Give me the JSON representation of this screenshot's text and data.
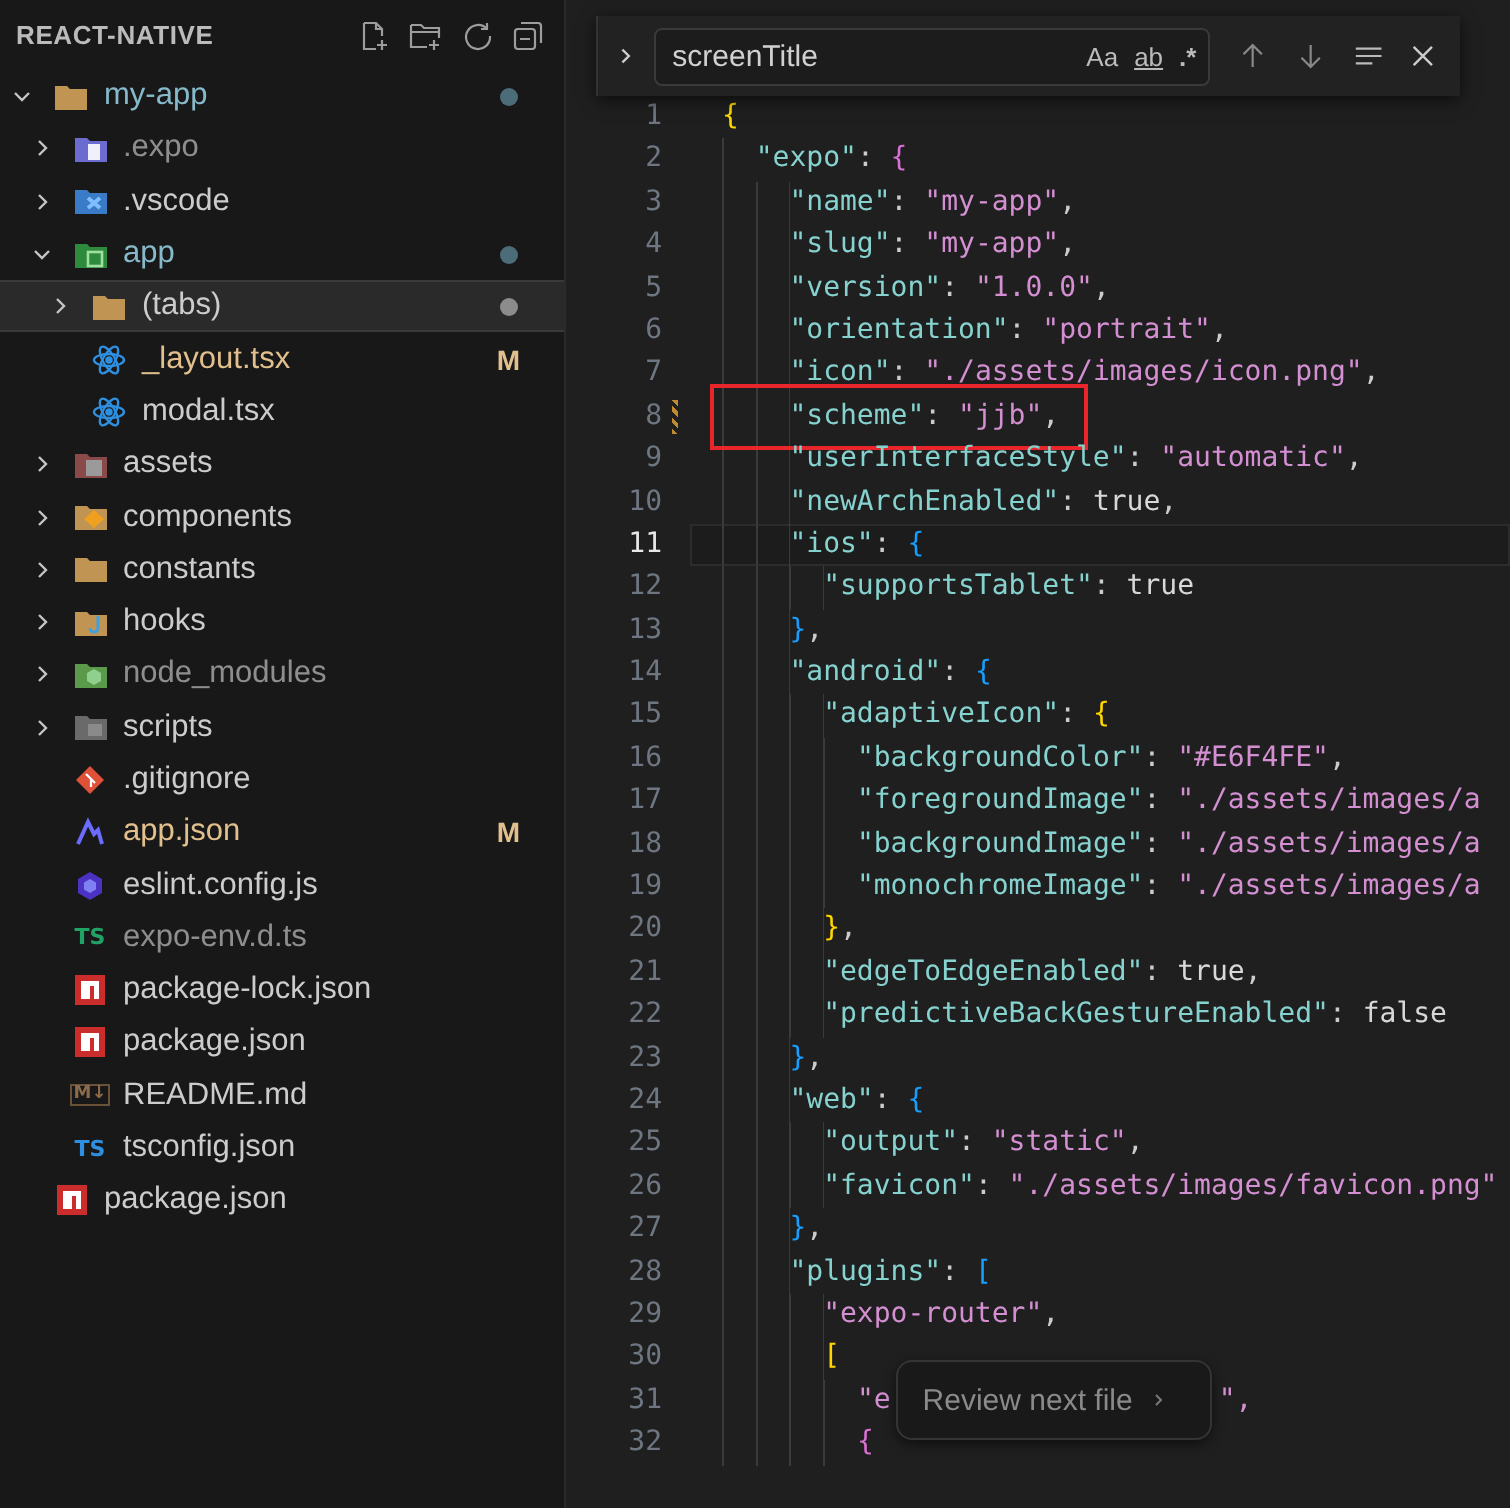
{
  "sidebar": {
    "title": "REACT-NATIVE",
    "tree": [
      {
        "name": "my-app",
        "kind": "folder",
        "expanded": true,
        "has_changes": true,
        "modified": false,
        "ignored": false,
        "selected": false,
        "color": "#4d6c7a",
        "children": [
          {
            "name": ".expo",
            "kind": "expo-folder",
            "expanded": false,
            "has_changes": false,
            "modified": false,
            "ignored": true,
            "selected": false
          },
          {
            "name": ".vscode",
            "kind": "vscode-folder",
            "expanded": false,
            "has_changes": false,
            "modified": false,
            "ignored": false,
            "selected": false
          },
          {
            "name": "app",
            "kind": "app-folder",
            "expanded": true,
            "has_changes": true,
            "modified": false,
            "ignored": false,
            "selected": false,
            "color": "#4d6c7a",
            "children": [
              {
                "name": "(tabs)",
                "kind": "folder",
                "expanded": false,
                "has_changes": false,
                "modified": false,
                "ignored": false,
                "selected": true,
                "color": "#8c8c8c"
              },
              {
                "name": "_layout.tsx",
                "kind": "react",
                "has_changes": false,
                "modified": true,
                "ignored": false,
                "selected": false,
                "badge": "M"
              },
              {
                "name": "modal.tsx",
                "kind": "react",
                "has_changes": false,
                "modified": false,
                "ignored": false,
                "selected": false
              }
            ]
          },
          {
            "name": "assets",
            "kind": "assets-folder",
            "expanded": false,
            "has_changes": false,
            "modified": false,
            "ignored": false,
            "selected": false
          },
          {
            "name": "components",
            "kind": "components-folder",
            "expanded": false,
            "has_changes": false,
            "modified": false,
            "ignored": false,
            "selected": false
          },
          {
            "name": "constants",
            "kind": "folder",
            "expanded": false,
            "has_changes": false,
            "modified": false,
            "ignored": false,
            "selected": false
          },
          {
            "name": "hooks",
            "kind": "hooks-folder",
            "expanded": false,
            "has_changes": false,
            "modified": false,
            "ignored": false,
            "selected": false
          },
          {
            "name": "node_modules",
            "kind": "node-folder",
            "expanded": false,
            "has_changes": false,
            "modified": false,
            "ignored": true,
            "selected": false
          },
          {
            "name": "scripts",
            "kind": "scripts-folder",
            "expanded": false,
            "has_changes": false,
            "modified": false,
            "ignored": false,
            "selected": false
          },
          {
            "name": ".gitignore",
            "kind": "git",
            "has_changes": false,
            "modified": false,
            "ignored": false,
            "selected": false
          },
          {
            "name": "app.json",
            "kind": "expo-file",
            "has_changes": false,
            "modified": true,
            "ignored": false,
            "selected": false,
            "badge": "M"
          },
          {
            "name": "eslint.config.js",
            "kind": "eslint",
            "has_changes": false,
            "modified": false,
            "ignored": false,
            "selected": false
          },
          {
            "name": "expo-env.d.ts",
            "kind": "ts",
            "glyph": "TS",
            "has_changes": false,
            "modified": false,
            "ignored": true,
            "selected": false
          },
          {
            "name": "package-lock.json",
            "kind": "npm",
            "has_changes": false,
            "modified": false,
            "ignored": false,
            "selected": false
          },
          {
            "name": "package.json",
            "kind": "npm",
            "has_changes": false,
            "modified": false,
            "ignored": false,
            "selected": false
          },
          {
            "name": "README.md",
            "kind": "markdown",
            "glyph": "M↓",
            "has_changes": false,
            "modified": false,
            "ignored": false,
            "selected": false
          },
          {
            "name": "tsconfig.json",
            "kind": "tsconfig",
            "glyph": "TS",
            "has_changes": false,
            "modified": false,
            "ignored": false,
            "selected": false
          }
        ]
      },
      {
        "name": "package.json",
        "kind": "npm",
        "has_changes": false,
        "modified": false,
        "ignored": false,
        "selected": false
      }
    ]
  },
  "find": {
    "value": "screenTitle",
    "options": [
      "Aa",
      "ab",
      ".*"
    ]
  },
  "editor": {
    "lines": [
      {
        "n": "1",
        "tokens": [
          {
            "t": "{",
            "kind": "bracket1"
          }
        ]
      },
      {
        "n": "2",
        "tokens": [
          {
            "t": "  \"expo\"",
            "kind": "key"
          },
          {
            "t": ": ",
            "kind": "punct"
          },
          {
            "t": "{",
            "kind": "bracket2"
          }
        ]
      },
      {
        "n": "3",
        "tokens": [
          {
            "t": "    \"name\"",
            "kind": "key"
          },
          {
            "t": ": ",
            "kind": "punct"
          },
          {
            "t": "\"my-app\"",
            "kind": "string"
          },
          {
            "t": ",",
            "kind": "punct"
          }
        ]
      },
      {
        "n": "4",
        "tokens": [
          {
            "t": "    \"slug\"",
            "kind": "key"
          },
          {
            "t": ": ",
            "kind": "punct"
          },
          {
            "t": "\"my-app\"",
            "kind": "string"
          },
          {
            "t": ",",
            "kind": "punct"
          }
        ]
      },
      {
        "n": "5",
        "tokens": [
          {
            "t": "    \"version\"",
            "kind": "key"
          },
          {
            "t": ": ",
            "kind": "punct"
          },
          {
            "t": "\"1.0.0\"",
            "kind": "string"
          },
          {
            "t": ",",
            "kind": "punct"
          }
        ]
      },
      {
        "n": "6",
        "tokens": [
          {
            "t": "    \"orientation\"",
            "kind": "key"
          },
          {
            "t": ": ",
            "kind": "punct"
          },
          {
            "t": "\"portrait\"",
            "kind": "string"
          },
          {
            "t": ",",
            "kind": "punct"
          }
        ]
      },
      {
        "n": "7",
        "tokens": [
          {
            "t": "    \"icon\"",
            "kind": "key"
          },
          {
            "t": ": ",
            "kind": "punct"
          },
          {
            "t": "\"./assets/images/icon.png\"",
            "kind": "string"
          },
          {
            "t": ",",
            "kind": "punct"
          }
        ]
      },
      {
        "n": "8",
        "boxed": true,
        "modified": true,
        "tokens": [
          {
            "t": "    \"scheme\"",
            "kind": "key"
          },
          {
            "t": ": ",
            "kind": "punct"
          },
          {
            "t": "\"jjb\"",
            "kind": "string"
          },
          {
            "t": ",",
            "kind": "punct"
          }
        ]
      },
      {
        "n": "9",
        "tokens": [
          {
            "t": "    \"userInterfaceStyle\"",
            "kind": "key"
          },
          {
            "t": ": ",
            "kind": "punct"
          },
          {
            "t": "\"automatic\"",
            "kind": "string"
          },
          {
            "t": ",",
            "kind": "punct"
          }
        ]
      },
      {
        "n": "10",
        "tokens": [
          {
            "t": "    \"newArchEnabled\"",
            "kind": "key"
          },
          {
            "t": ": ",
            "kind": "punct"
          },
          {
            "t": "true",
            "kind": "literal"
          },
          {
            "t": ",",
            "kind": "punct"
          }
        ]
      },
      {
        "n": "11",
        "current": true,
        "tokens": [
          {
            "t": "    \"ios\"",
            "kind": "key"
          },
          {
            "t": ": ",
            "kind": "punct"
          },
          {
            "t": "{",
            "kind": "bracket3"
          }
        ]
      },
      {
        "n": "12",
        "tokens": [
          {
            "t": "      \"supportsTablet\"",
            "kind": "key"
          },
          {
            "t": ": ",
            "kind": "punct"
          },
          {
            "t": "true",
            "kind": "literal"
          }
        ]
      },
      {
        "n": "13",
        "tokens": [
          {
            "t": "    }",
            "kind": "bracket3"
          },
          {
            "t": ",",
            "kind": "punct"
          }
        ]
      },
      {
        "n": "14",
        "tokens": [
          {
            "t": "    \"android\"",
            "kind": "key"
          },
          {
            "t": ": ",
            "kind": "punct"
          },
          {
            "t": "{",
            "kind": "bracket3"
          }
        ]
      },
      {
        "n": "15",
        "tokens": [
          {
            "t": "      \"adaptiveIcon\"",
            "kind": "key"
          },
          {
            "t": ": ",
            "kind": "punct"
          },
          {
            "t": "{",
            "kind": "bracket1"
          }
        ]
      },
      {
        "n": "16",
        "tokens": [
          {
            "t": "        \"backgroundColor\"",
            "kind": "key"
          },
          {
            "t": ": ",
            "kind": "punct"
          },
          {
            "t": "\"#E6F4FE\"",
            "kind": "string"
          },
          {
            "t": ",",
            "kind": "punct"
          }
        ]
      },
      {
        "n": "17",
        "tokens": [
          {
            "t": "        \"foregroundImage\"",
            "kind": "key"
          },
          {
            "t": ": ",
            "kind": "punct"
          },
          {
            "t": "\"./assets/images/a",
            "kind": "string"
          }
        ]
      },
      {
        "n": "18",
        "tokens": [
          {
            "t": "        \"backgroundImage\"",
            "kind": "key"
          },
          {
            "t": ": ",
            "kind": "punct"
          },
          {
            "t": "\"./assets/images/a",
            "kind": "string"
          }
        ]
      },
      {
        "n": "19",
        "tokens": [
          {
            "t": "        \"monochromeImage\"",
            "kind": "key"
          },
          {
            "t": ": ",
            "kind": "punct"
          },
          {
            "t": "\"./assets/images/a",
            "kind": "string"
          }
        ]
      },
      {
        "n": "20",
        "tokens": [
          {
            "t": "      }",
            "kind": "bracket1"
          },
          {
            "t": ",",
            "kind": "punct"
          }
        ]
      },
      {
        "n": "21",
        "tokens": [
          {
            "t": "      \"edgeToEdgeEnabled\"",
            "kind": "key"
          },
          {
            "t": ": ",
            "kind": "punct"
          },
          {
            "t": "true",
            "kind": "literal"
          },
          {
            "t": ",",
            "kind": "punct"
          }
        ]
      },
      {
        "n": "22",
        "tokens": [
          {
            "t": "      \"predictiveBackGestureEnabled\"",
            "kind": "key"
          },
          {
            "t": ": ",
            "kind": "punct"
          },
          {
            "t": "false",
            "kind": "literal"
          }
        ]
      },
      {
        "n": "23",
        "tokens": [
          {
            "t": "    }",
            "kind": "bracket3"
          },
          {
            "t": ",",
            "kind": "punct"
          }
        ]
      },
      {
        "n": "24",
        "tokens": [
          {
            "t": "    \"web\"",
            "kind": "key"
          },
          {
            "t": ": ",
            "kind": "punct"
          },
          {
            "t": "{",
            "kind": "bracket3"
          }
        ]
      },
      {
        "n": "25",
        "tokens": [
          {
            "t": "      \"output\"",
            "kind": "key"
          },
          {
            "t": ": ",
            "kind": "punct"
          },
          {
            "t": "\"static\"",
            "kind": "string"
          },
          {
            "t": ",",
            "kind": "punct"
          }
        ]
      },
      {
        "n": "26",
        "tokens": [
          {
            "t": "      \"favicon\"",
            "kind": "key"
          },
          {
            "t": ": ",
            "kind": "punct"
          },
          {
            "t": "\"./assets/images/favicon.png\"",
            "kind": "string"
          }
        ]
      },
      {
        "n": "27",
        "tokens": [
          {
            "t": "    }",
            "kind": "bracket3"
          },
          {
            "t": ",",
            "kind": "punct"
          }
        ]
      },
      {
        "n": "28",
        "tokens": [
          {
            "t": "    \"plugins\"",
            "kind": "key"
          },
          {
            "t": ": ",
            "kind": "punct"
          },
          {
            "t": "[",
            "kind": "bracket3"
          }
        ]
      },
      {
        "n": "29",
        "tokens": [
          {
            "t": "      \"expo-router\"",
            "kind": "string"
          },
          {
            "t": ",",
            "kind": "punct"
          }
        ]
      },
      {
        "n": "30",
        "tokens": [
          {
            "t": "      [",
            "kind": "bracket1"
          }
        ]
      },
      {
        "n": "31",
        "tokens": [
          {
            "t": "        \"e",
            "kind": "string"
          },
          {
            "t": "Review next file",
            "kind": "popup"
          },
          {
            "t": "\",",
            "kind": "string"
          }
        ]
      },
      {
        "n": "32",
        "tokens": [
          {
            "t": "        {",
            "kind": "bracket2"
          }
        ]
      }
    ]
  }
}
